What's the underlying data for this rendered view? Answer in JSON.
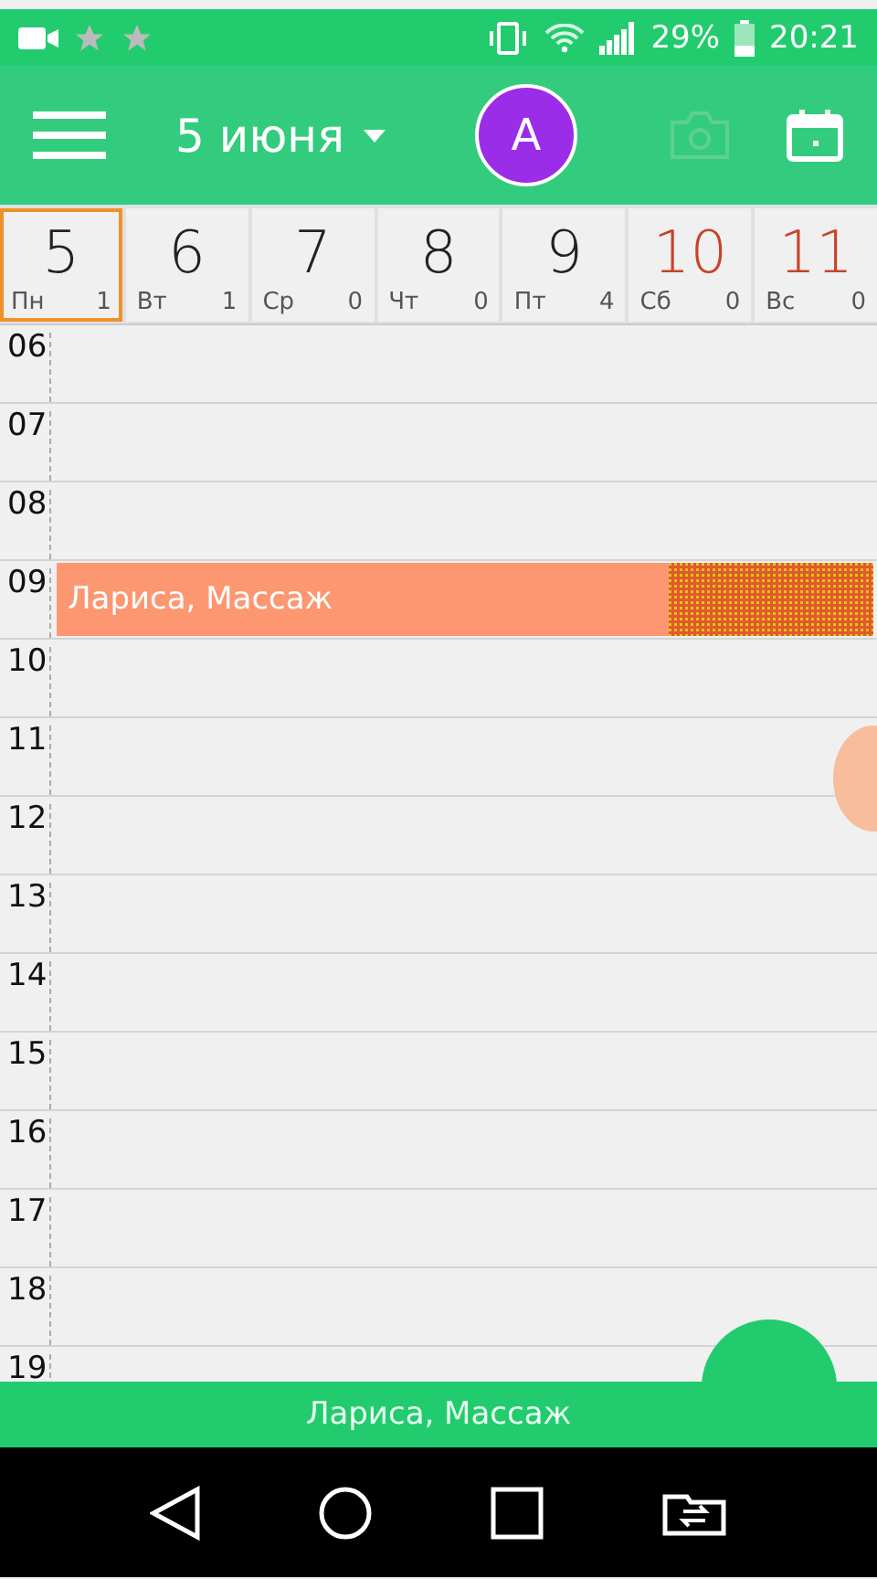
{
  "status_bar": {
    "battery": "29%",
    "time": "20:21"
  },
  "app_bar": {
    "title": "5 июня",
    "avatar": "A"
  },
  "days": [
    {
      "number": "5",
      "weekday": "Пн",
      "count": "1",
      "selected": true,
      "weekend": false
    },
    {
      "number": "6",
      "weekday": "Вт",
      "count": "1",
      "selected": false,
      "weekend": false
    },
    {
      "number": "7",
      "weekday": "Ср",
      "count": "0",
      "selected": false,
      "weekend": false
    },
    {
      "number": "8",
      "weekday": "Чт",
      "count": "0",
      "selected": false,
      "weekend": false
    },
    {
      "number": "9",
      "weekday": "Пт",
      "count": "4",
      "selected": false,
      "weekend": false
    },
    {
      "number": "10",
      "weekday": "Сб",
      "count": "0",
      "selected": false,
      "weekend": true
    },
    {
      "number": "11",
      "weekday": "Вс",
      "count": "0",
      "selected": false,
      "weekend": true
    }
  ],
  "hours": [
    {
      "label": "06"
    },
    {
      "label": "07"
    },
    {
      "label": "08"
    },
    {
      "label": "09",
      "events": [
        {
          "title": "Лариса, Массаж"
        }
      ]
    },
    {
      "label": "10"
    },
    {
      "label": "11"
    },
    {
      "label": "12"
    },
    {
      "label": "13"
    },
    {
      "label": "14"
    },
    {
      "label": "15"
    },
    {
      "label": "16"
    },
    {
      "label": "17"
    },
    {
      "label": "18"
    },
    {
      "label": "19"
    }
  ],
  "bottom_bar": {
    "text": "Лариса, Массаж"
  }
}
